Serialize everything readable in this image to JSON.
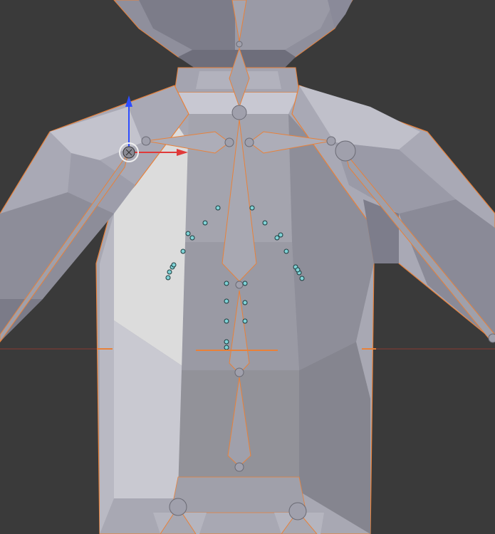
{
  "viewport": {
    "background": "#3a3a3a",
    "mesh_light": "#b9b9c2",
    "mesh_mid": "#9c9ca8",
    "mesh_dark": "#7a7a88",
    "outline_color": "#e8813a",
    "bone_color": "#a9a9b4",
    "joint_color": "#9a9aa6",
    "weight_dot_color": "#7fd2d6",
    "x_axis_color": "#e03a3a",
    "y_axis_color": "#2e4dff"
  },
  "scene": {
    "object": "armature-character",
    "bones": [
      "spine-upper",
      "spine-lower",
      "neck",
      "clavicle-left",
      "clavicle-right",
      "pelvis-left",
      "pelvis-right"
    ],
    "gizmo": {
      "type": "transform-manipulator",
      "axes": [
        "x",
        "y"
      ]
    }
  }
}
